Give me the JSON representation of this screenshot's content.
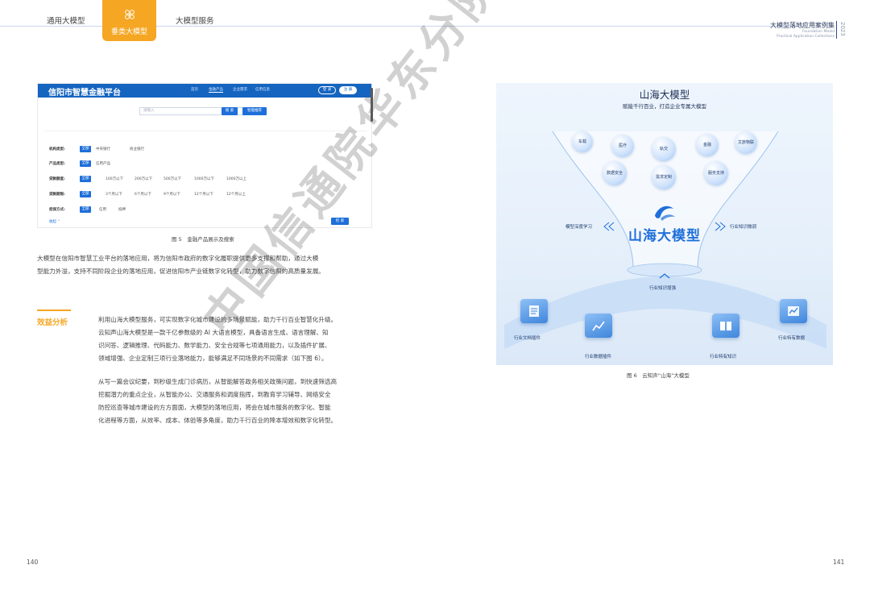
{
  "header": {
    "tabs": [
      "通用大模型",
      "垂类大模型",
      "大模型服务"
    ],
    "active_tab": "垂类大模型",
    "brand_title": "大模型落地应用案例集",
    "brand_sub1": "Foundation Model",
    "brand_sub2": "Practical Application Collections",
    "year": "2023"
  },
  "fig5": {
    "platform_title": "信阳市智慧金融平台",
    "nav": [
      "首页",
      "金融产品",
      "企业需求",
      "信用信息"
    ],
    "login": "登 录",
    "register": "注 册",
    "search_placeholder": "请输入",
    "search_btn": "搜 索",
    "advanced_btn": "智能推荐",
    "filters": [
      {
        "key": "机构类型:",
        "selected": "全部",
        "options": [
          "中央银行",
          "商业银行"
        ]
      },
      {
        "key": "产品类型:",
        "selected": "全部",
        "options": [
          "信用产品"
        ]
      },
      {
        "key": "贷款额度:",
        "selected": "全部",
        "options": [
          "100万以下",
          "200万以下",
          "500万以下",
          "1000万以下",
          "1000万以上"
        ]
      },
      {
        "key": "贷款期限:",
        "selected": "全部",
        "options": [
          "3个月以下",
          "6个月以下",
          "9个月以下",
          "12个月以下",
          "12个月以上"
        ]
      },
      {
        "key": "担保方式:",
        "selected": "全部",
        "options": [
          "信用",
          "抵押"
        ]
      }
    ],
    "collapse": "收起 ⌃",
    "search2": "检 索"
  },
  "fig5_caption": "图 5　金融产品展示及搜索",
  "para1_lines": [
    "大模型在信阳市智慧工业平台的落地应用，将为信阳市政府的数字化履职提供更多支撑和帮助，通过大模",
    "型能力外溢，支持不同阶段企业的落地应用，促进信阳市产业链数字化转型，助力数字信阳的高质量发展。"
  ],
  "section": {
    "title": "效益分析",
    "p1_lines": [
      "利用山海大模型服务，可实现数字化城市建设的多场景赋能，助力千行百业智慧化升级。",
      "云知声山海大模型是一款千亿参数级的 AI 大语言模型，具备语言生成、语言理解、知",
      "识问答、逻辑推理、代码能力、数学能力、安全合规等七项通用能力，以及插件扩展、",
      "领域增强、企业定制三项行业落地能力，能够满足不同场景的不同需求（如下图 6）。"
    ],
    "p2_lines": [
      "从写一篇会议纪要，到秒级生成门诊病历，从智能解答政务相关政策问题，到快速筛选高",
      "挖掘潜力的重点企业，从智能办公、交通服务和调度指挥，到教育学习辅导、网络安全",
      "防控巡查等城市建设的方方面面，大模型的落地应用，将会在城市服务的数字化、智能",
      "化进程等方面，从效率、成本、体验等多角度，助力千行百业的降本增效和数字化转型。"
    ]
  },
  "fig6": {
    "title": "山海大模型",
    "subtitle": "赋能千行百业，打造企业专属大模型",
    "bubbles": [
      "车载",
      "医疗",
      "轨交",
      "金融",
      "文旅物联",
      "数据安全",
      "需求定制",
      "服务支持"
    ],
    "left_label": "模型深度学习",
    "right_label": "行业知识微调",
    "brand": "山海大模型",
    "bottom_label": "行业知识增强",
    "tiles": [
      "行业文档插件",
      "行业数据插件",
      "行业特有知识",
      "行业特有数据"
    ]
  },
  "fig6_caption": "图 6　云知声“山海”大模型",
  "watermark": "中国信通院华东分院",
  "page_left": "140",
  "page_right": "141"
}
